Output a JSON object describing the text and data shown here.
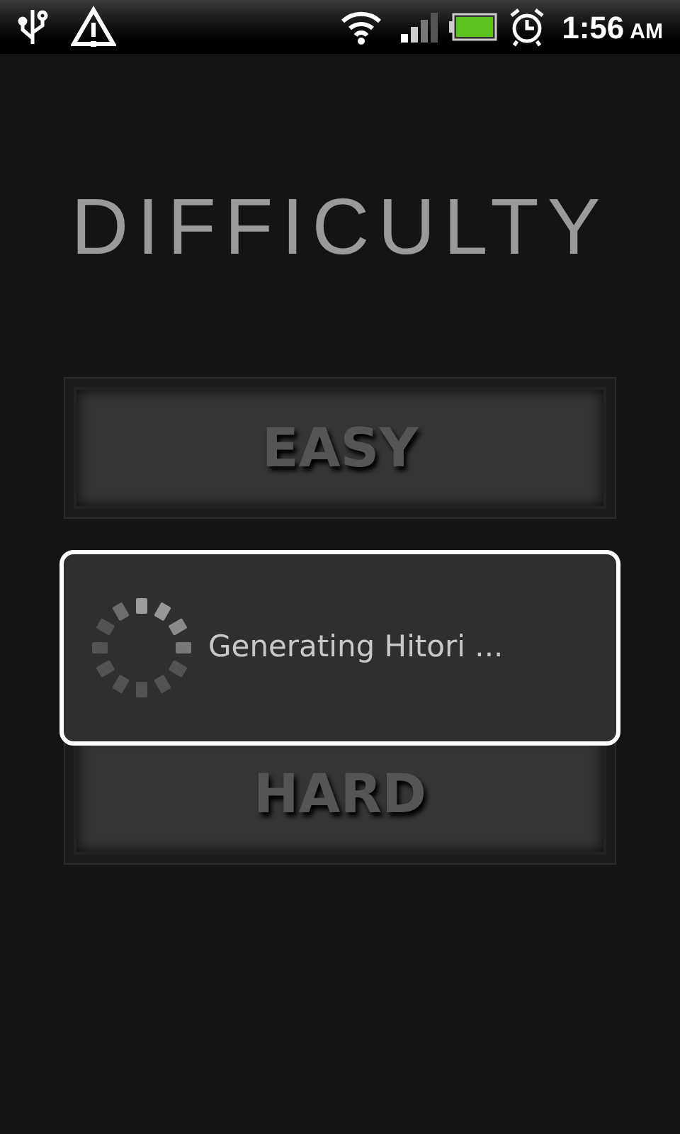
{
  "status_bar": {
    "time": "1:56",
    "period": "AM"
  },
  "title": "DIFFICULTY",
  "buttons": [
    {
      "label": "EASY"
    },
    {
      "label": "HARD"
    }
  ],
  "dialog": {
    "message": "Generating Hitori ..."
  }
}
